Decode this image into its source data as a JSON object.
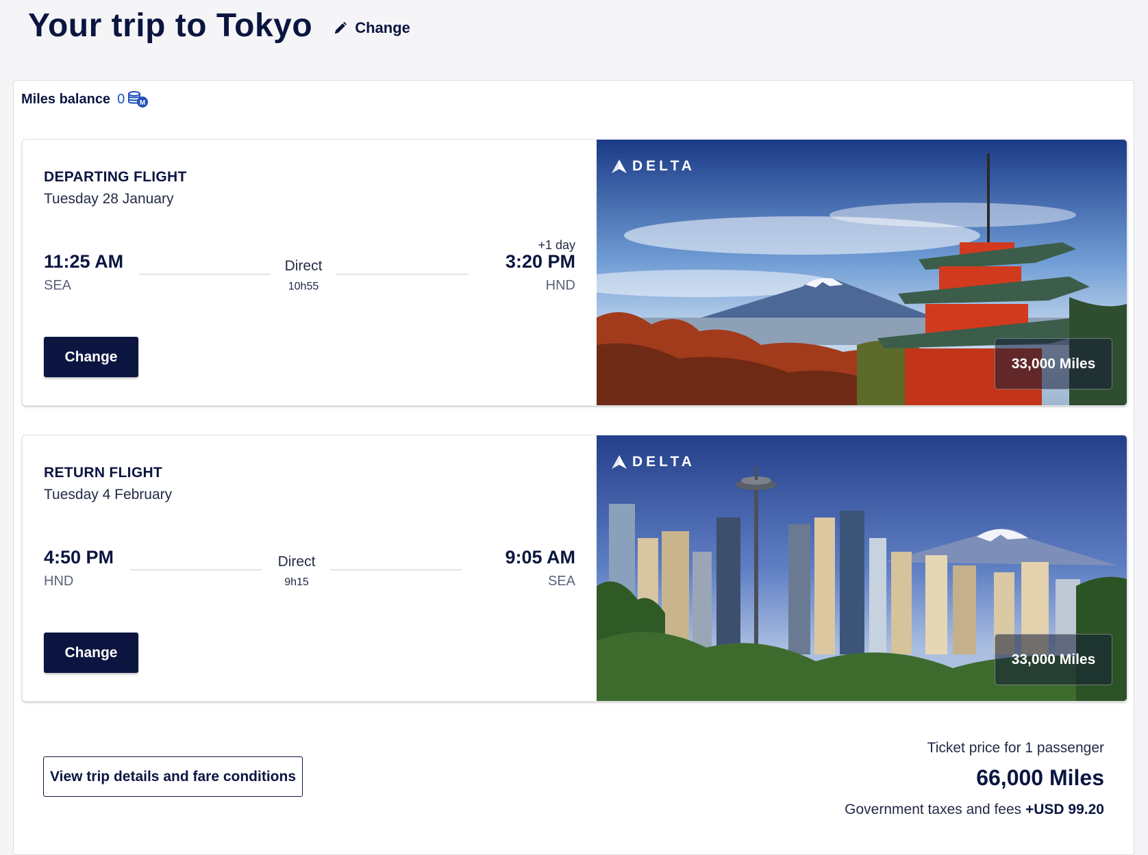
{
  "header": {
    "title": "Your trip to Tokyo",
    "change_label": "Change"
  },
  "miles_balance": {
    "label": "Miles balance",
    "value": "0",
    "icon": "miles-coins-icon"
  },
  "flights": [
    {
      "label": "DEPARTING FLIGHT",
      "date": "Tuesday 28 January",
      "departure_time": "11:25 AM",
      "departure_code": "SEA",
      "stop_type": "Direct",
      "duration": "10h55",
      "arrival_note": "+1 day",
      "arrival_time": "3:20 PM",
      "arrival_code": "HND",
      "change_label": "Change",
      "airline": "DELTA",
      "price": "33,000 Miles",
      "image": "tokyo-pagoda-mount-fuji"
    },
    {
      "label": "RETURN FLIGHT",
      "date": "Tuesday 4 February",
      "departure_time": "4:50 PM",
      "departure_code": "HND",
      "stop_type": "Direct",
      "duration": "9h15",
      "arrival_note": "",
      "arrival_time": "9:05 AM",
      "arrival_code": "SEA",
      "change_label": "Change",
      "airline": "DELTA",
      "price": "33,000 Miles",
      "image": "seattle-skyline-mount-rainier"
    }
  ],
  "footer": {
    "details_button": "View trip details and fare conditions",
    "ticket_label": "Ticket price for 1 passenger",
    "total_miles": "66,000 Miles",
    "taxes_label": "Government taxes and fees",
    "taxes_amount": "+USD 99.20"
  },
  "colors": {
    "navy": "#0b1540",
    "accent_blue": "#1f4fb8",
    "background": "#f5f5f7"
  }
}
